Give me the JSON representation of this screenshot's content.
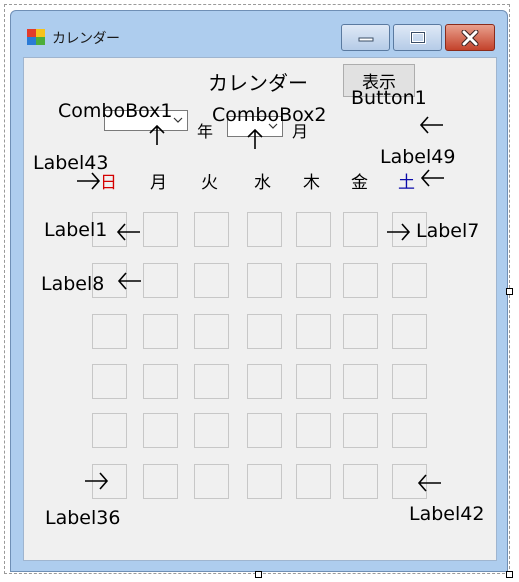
{
  "window": {
    "title": "カレンダー",
    "minimize_icon": "minimize-icon",
    "maximize_icon": "maximize-icon",
    "close_icon": "close-icon"
  },
  "form": {
    "heading": "カレンダー",
    "year_suffix": "年",
    "month_suffix": "月",
    "button1_text": "表示",
    "weekdays": [
      "日",
      "月",
      "火",
      "水",
      "木",
      "金",
      "土"
    ],
    "colors": {
      "sunday": "#d40000",
      "saturday": "#0a0aaa"
    }
  },
  "annotations": {
    "combobox1": "ComboBox1",
    "combobox2": "ComboBox2",
    "button1": "Button1",
    "label43": "Label43",
    "label49": "Label49",
    "label1": "Label1",
    "label7": "Label7",
    "label8": "Label8",
    "label36": "Label36",
    "label42": "Label42"
  }
}
